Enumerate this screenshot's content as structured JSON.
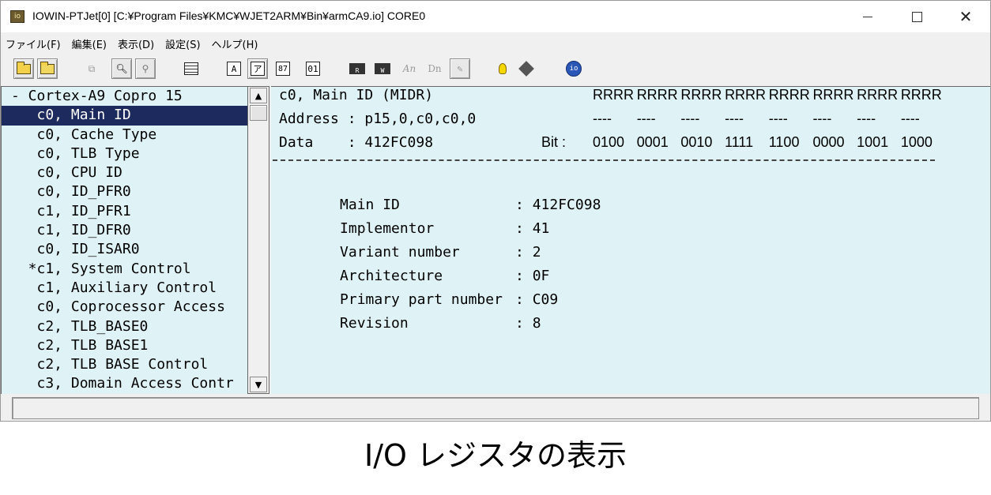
{
  "window": {
    "title": "IOWIN-PTJet[0] [C:¥Program Files¥KMC¥WJET2ARM¥Bin¥armCA9.io]  CORE0",
    "icon_label": "io"
  },
  "menu": {
    "items": [
      "ファイル(F)",
      "編集(E)",
      "表示(D)",
      "設定(S)",
      "ヘルプ(H)"
    ]
  },
  "toolbar": {
    "buttons": [
      {
        "icon": "open-folder-icon"
      },
      {
        "icon": "refresh-folder-icon"
      },
      {
        "icon": "copy-icon"
      },
      {
        "icon": "search-icon"
      },
      {
        "icon": "search-next-icon"
      },
      {
        "icon": "list-icon"
      },
      {
        "label": "A"
      },
      {
        "label": "ア"
      },
      {
        "label": "87"
      },
      {
        "label": "01"
      },
      {
        "label": "R"
      },
      {
        "label": "W"
      },
      {
        "label": "An"
      },
      {
        "label": "Dn"
      },
      {
        "icon": "pen-icon"
      },
      {
        "icon": "bulb-icon"
      },
      {
        "icon": "diamond-icon"
      },
      {
        "label": "io"
      }
    ]
  },
  "tree": {
    "items": [
      "- Cortex-A9 Copro 15",
      "   c0, Main ID",
      "   c0, Cache Type",
      "   c0, TLB Type",
      "   c0, CPU ID",
      "   c0, ID_PFR0",
      "   c1, ID_PFR1",
      "   c1, ID_DFR0",
      "   c0, ID_ISAR0",
      "  *c1, System Control",
      "   c1, Auxiliary Control",
      "   c0, Coprocessor Access",
      "   c2, TLB_BASE0",
      "   c2, TLB BASE1",
      "   c2, TLB BASE Control",
      "   c3, Domain Access Contr"
    ],
    "selected_index": 1
  },
  "detail": {
    "register_name": "c0, Main ID (MIDR)",
    "address": "Address : p15,0,c0,c0,0",
    "data": "Data    : 412FC098",
    "bit_label": "Bit :",
    "access_row": [
      "RRRR",
      "RRRR",
      "RRRR",
      "RRRR",
      "RRRR",
      "RRRR",
      "RRRR",
      "RRRR"
    ],
    "dash_row": [
      "----",
      "----",
      "----",
      "----",
      "----",
      "----",
      "----",
      "----"
    ],
    "bit_row": [
      "0100",
      "0001",
      "0010",
      "1111",
      "1100",
      "0000",
      "1001",
      "1000"
    ],
    "fields": [
      {
        "label": "Main ID",
        "value": ": 412FC098"
      },
      {
        "label": "Implementor",
        "value": ": 41"
      },
      {
        "label": "Variant number",
        "value": ": 2"
      },
      {
        "label": "Architecture",
        "value": ": 0F"
      },
      {
        "label": "Primary part number",
        "value": ": C09"
      },
      {
        "label": "Revision",
        "value": ": 8"
      }
    ]
  },
  "caption": "I/O レジスタの表示"
}
